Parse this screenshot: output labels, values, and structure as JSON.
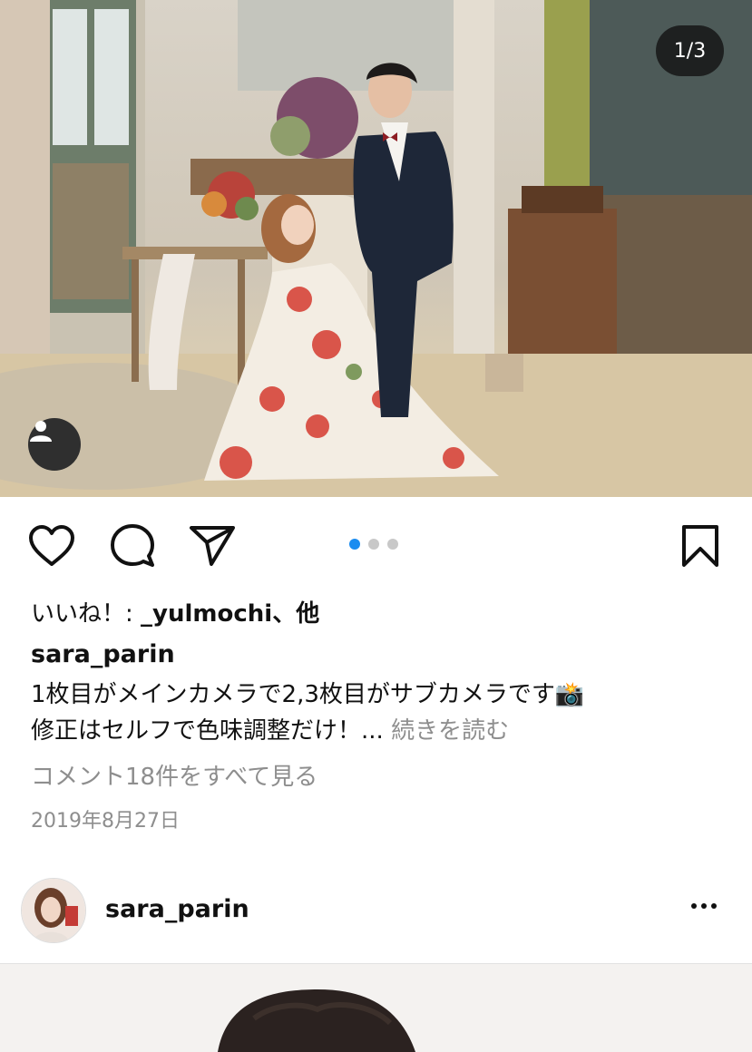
{
  "post": {
    "image_counter": "1/3",
    "carousel": {
      "count": 3,
      "active": 0
    },
    "likes_prefix": "いいね！: ",
    "likes_user": "_yulmochi",
    "likes_suffix": "、他",
    "username": "sara_parin",
    "caption_line1": "1枚目がメインカメラで2,3枚目がサブカメラです📸",
    "caption_line2": "修正はセルフで色味調整だけ！...",
    "more_label": "続きを読む",
    "view_comments": "コメント18件をすべて見る",
    "date": "2019年8月27日"
  },
  "next_post": {
    "username": "sara_parin"
  },
  "icons": {
    "like": "heart-icon",
    "comment": "comment-icon",
    "share": "send-icon",
    "save": "bookmark-icon",
    "tag": "user-tag-icon",
    "menu": "more-icon"
  }
}
